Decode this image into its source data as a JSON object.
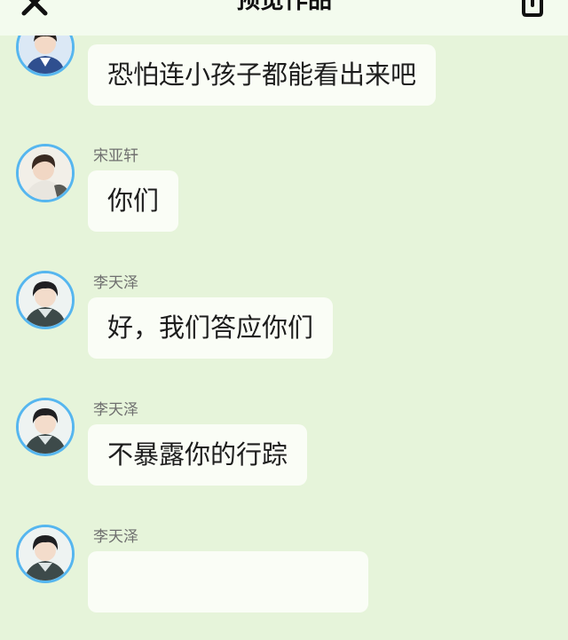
{
  "header": {
    "title": "预览作品",
    "close_icon": "close-icon",
    "share_icon": "share-icon"
  },
  "messages": [
    {
      "name": "",
      "text": "恐怕连小孩子都能看出来吧",
      "avatar": "avatar-boy-blue-uniform"
    },
    {
      "name": "宋亚轩",
      "text": "你们",
      "avatar": "avatar-boy-white-shirt"
    },
    {
      "name": "李天泽",
      "text": "好，我们答应你们",
      "avatar": "avatar-boy-dark-jacket"
    },
    {
      "name": "李天泽",
      "text": "不暴露你的行踪",
      "avatar": "avatar-boy-dark-jacket"
    },
    {
      "name": "李天泽",
      "text": "",
      "avatar": "avatar-boy-dark-jacket"
    }
  ],
  "colors": {
    "background": "#e6f4da",
    "header": "#f3fbee",
    "bubble": "#fafdf6",
    "avatar_ring": "#56b6ef"
  }
}
